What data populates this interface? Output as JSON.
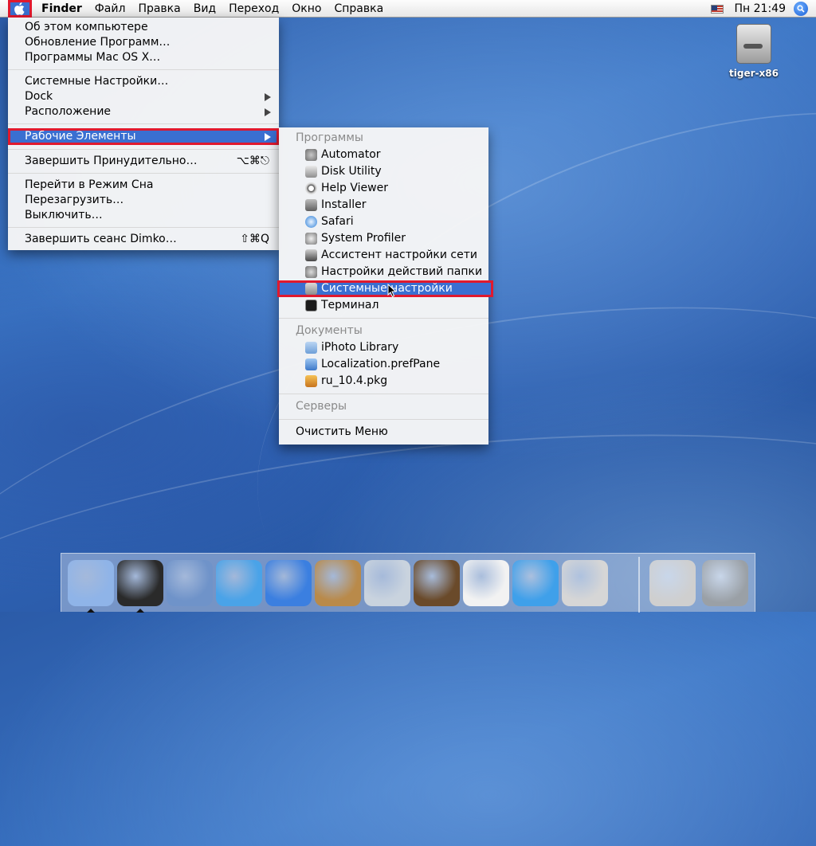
{
  "menubar": {
    "app_name": "Finder",
    "menus": [
      "Файл",
      "Правка",
      "Вид",
      "Переход",
      "Окно",
      "Справка"
    ],
    "clock": "Пн 21:49",
    "apple_icon": "apple-logo-icon",
    "flag_icon": "us-flag-icon",
    "spotlight_icon": "spotlight-icon"
  },
  "apple_menu": {
    "items": [
      {
        "label": "Об этом компьютере"
      },
      {
        "label": "Обновление Программ…"
      },
      {
        "label": "Программы Mac OS X…"
      },
      {
        "label": "Системные Настройки…"
      },
      {
        "label": "Dock"
      },
      {
        "label": "Расположение"
      },
      {
        "label": "Рабочие Элементы"
      },
      {
        "label": "Завершить Принудительно…",
        "shortcut": "⌥⌘⎋"
      },
      {
        "label": "Перейти в Режим Сна"
      },
      {
        "label": "Перезагрузить…"
      },
      {
        "label": "Выключить…"
      },
      {
        "label": "Завершить сеанс Dimko…",
        "shortcut": "⇧⌘Q"
      }
    ]
  },
  "recent_menu": {
    "apps_header": "Программы",
    "apps": [
      {
        "label": "Automator",
        "icon": "automator-icon"
      },
      {
        "label": "Disk Utility",
        "icon": "disk-utility-icon"
      },
      {
        "label": "Help Viewer",
        "icon": "help-viewer-icon"
      },
      {
        "label": "Installer",
        "icon": "installer-icon"
      },
      {
        "label": "Safari",
        "icon": "safari-icon"
      },
      {
        "label": "System Profiler",
        "icon": "system-profiler-icon"
      },
      {
        "label": "Ассистент настройки сети",
        "icon": "network-assistant-icon"
      },
      {
        "label": "Настройки действий папки",
        "icon": "folder-actions-icon"
      },
      {
        "label": "Системные настройки",
        "icon": "system-preferences-icon"
      },
      {
        "label": "Терминал",
        "icon": "terminal-icon"
      }
    ],
    "docs_header": "Документы",
    "docs": [
      {
        "label": "iPhoto Library",
        "icon": "folder-icon"
      },
      {
        "label": "Localization.prefPane",
        "icon": "prefpane-icon"
      },
      {
        "label": "ru_10.4.pkg",
        "icon": "package-icon"
      }
    ],
    "servers_header": "Серверы",
    "clear_label": "Очистить Меню"
  },
  "desktop": {
    "hd_label": "tiger-x86"
  },
  "dock": {
    "apps": [
      {
        "name": "finder-icon",
        "color": "#8fb4e8"
      },
      {
        "name": "dashboard-icon",
        "color": "#2a2a2a"
      },
      {
        "name": "mail-icon",
        "color": "#6f93c9"
      },
      {
        "name": "safari-icon",
        "color": "#4aa3e8"
      },
      {
        "name": "ichat-icon",
        "color": "#3b7fe0"
      },
      {
        "name": "address-book-icon",
        "color": "#b98a4a"
      },
      {
        "name": "itunes-icon",
        "color": "#c9d3de"
      },
      {
        "name": "iphoto-icon",
        "color": "#6a4a2a"
      },
      {
        "name": "ical-icon",
        "color": "#f2f2f2"
      },
      {
        "name": "quicktime-icon",
        "color": "#3fa0ea"
      },
      {
        "name": "system-preferences-icon",
        "color": "#d6d6d6"
      }
    ],
    "right": [
      {
        "name": "mail-stamp-icon",
        "color": "#cfcfcf"
      },
      {
        "name": "trash-icon",
        "color": "#9aa0a6"
      }
    ]
  }
}
